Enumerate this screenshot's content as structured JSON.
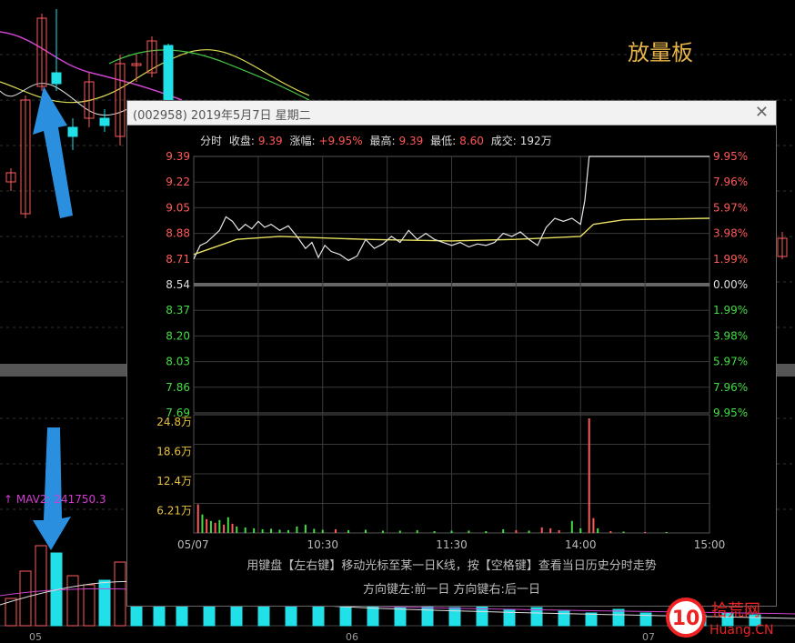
{
  "background": {
    "title": "放量板",
    "ma_label": "↑ MAV",
    "ma_value": "2: 241750.3",
    "x_labels": [
      "05",
      "06",
      "07"
    ]
  },
  "dialog": {
    "title": "(002958) 2019年5月7日 星期二",
    "close_glyph": "✕",
    "info": {
      "mode": "分时",
      "close_label": "收盘:",
      "close_value": "9.39",
      "change_label": "涨幅:",
      "change_value": "+9.95%",
      "high_label": "最高:",
      "high_value": "9.39",
      "low_label": "最低:",
      "low_value": "8.60",
      "volume_label": "成交:",
      "volume_value": "192万"
    },
    "footer_line1": "用键盘【左右键】移动光标至某一日K线，按【空格键】查看当日历史分时走势",
    "footer_line2": "方向键左:前一日   方向键右:后一日"
  },
  "chart_data": {
    "type": "line",
    "price_ticks_up": [
      "9.39",
      "9.22",
      "9.05",
      "8.88",
      "8.71"
    ],
    "price_ticks_mid": "8.54",
    "price_ticks_down": [
      "8.37",
      "8.20",
      "8.03",
      "7.86",
      "7.69"
    ],
    "pct_ticks_up": [
      "9.95%",
      "7.96%",
      "5.97%",
      "3.98%",
      "1.99%"
    ],
    "pct_ticks_mid": "0.00%",
    "pct_ticks_down": [
      "1.99%",
      "3.98%",
      "5.97%",
      "7.96%",
      "9.95%"
    ],
    "volume_ticks": [
      "24.8万",
      "18.6万",
      "12.4万",
      "6.21万"
    ],
    "x_ticks": [
      "05/07",
      "10:30",
      "11:30",
      "14:00",
      "15:00"
    ],
    "ylim": [
      7.69,
      9.39
    ],
    "volume_max": 248000,
    "price_series": [
      {
        "t": 0,
        "p": 8.71
      },
      {
        "t": 3,
        "p": 8.8
      },
      {
        "t": 6,
        "p": 8.82
      },
      {
        "t": 9,
        "p": 8.86
      },
      {
        "t": 12,
        "p": 8.9
      },
      {
        "t": 15,
        "p": 8.99
      },
      {
        "t": 18,
        "p": 8.96
      },
      {
        "t": 21,
        "p": 8.9
      },
      {
        "t": 24,
        "p": 8.94
      },
      {
        "t": 27,
        "p": 8.91
      },
      {
        "t": 30,
        "p": 8.96
      },
      {
        "t": 33,
        "p": 8.92
      },
      {
        "t": 36,
        "p": 8.94
      },
      {
        "t": 40,
        "p": 8.9
      },
      {
        "t": 44,
        "p": 8.93
      },
      {
        "t": 48,
        "p": 8.86
      },
      {
        "t": 52,
        "p": 8.78
      },
      {
        "t": 55,
        "p": 8.82
      },
      {
        "t": 58,
        "p": 8.72
      },
      {
        "t": 61,
        "p": 8.8
      },
      {
        "t": 64,
        "p": 8.76
      },
      {
        "t": 68,
        "p": 8.74
      },
      {
        "t": 72,
        "p": 8.7
      },
      {
        "t": 76,
        "p": 8.73
      },
      {
        "t": 80,
        "p": 8.84
      },
      {
        "t": 84,
        "p": 8.78
      },
      {
        "t": 88,
        "p": 8.81
      },
      {
        "t": 92,
        "p": 8.86
      },
      {
        "t": 96,
        "p": 8.82
      },
      {
        "t": 100,
        "p": 8.9
      },
      {
        "t": 104,
        "p": 8.84
      },
      {
        "t": 108,
        "p": 8.88
      },
      {
        "t": 112,
        "p": 8.84
      },
      {
        "t": 116,
        "p": 8.82
      },
      {
        "t": 120,
        "p": 8.8
      },
      {
        "t": 124,
        "p": 8.82
      },
      {
        "t": 128,
        "p": 8.79
      },
      {
        "t": 132,
        "p": 8.81
      },
      {
        "t": 136,
        "p": 8.8
      },
      {
        "t": 140,
        "p": 8.82
      },
      {
        "t": 144,
        "p": 8.88
      },
      {
        "t": 148,
        "p": 8.86
      },
      {
        "t": 152,
        "p": 8.89
      },
      {
        "t": 156,
        "p": 8.84
      },
      {
        "t": 160,
        "p": 8.8
      },
      {
        "t": 164,
        "p": 8.92
      },
      {
        "t": 168,
        "p": 8.98
      },
      {
        "t": 172,
        "p": 8.96
      },
      {
        "t": 176,
        "p": 8.98
      },
      {
        "t": 180,
        "p": 8.94
      },
      {
        "t": 182,
        "p": 9.1
      },
      {
        "t": 184,
        "p": 9.39
      },
      {
        "t": 190,
        "p": 9.39
      },
      {
        "t": 240,
        "p": 9.39
      }
    ],
    "avg_series": [
      {
        "t": 0,
        "p": 8.74
      },
      {
        "t": 20,
        "p": 8.84
      },
      {
        "t": 40,
        "p": 8.86
      },
      {
        "t": 80,
        "p": 8.84
      },
      {
        "t": 120,
        "p": 8.83
      },
      {
        "t": 150,
        "p": 8.84
      },
      {
        "t": 180,
        "p": 8.86
      },
      {
        "t": 186,
        "p": 8.94
      },
      {
        "t": 200,
        "p": 8.97
      },
      {
        "t": 240,
        "p": 8.98
      }
    ],
    "volume_series": [
      {
        "t": 2,
        "v": 62000
      },
      {
        "t": 4,
        "v": 40000
      },
      {
        "t": 6,
        "v": 30000
      },
      {
        "t": 8,
        "v": 26000
      },
      {
        "t": 10,
        "v": 22000
      },
      {
        "t": 12,
        "v": 28000
      },
      {
        "t": 14,
        "v": 18000
      },
      {
        "t": 16,
        "v": 34000
      },
      {
        "t": 18,
        "v": 20000
      },
      {
        "t": 20,
        "v": 14000
      },
      {
        "t": 24,
        "v": 12000
      },
      {
        "t": 28,
        "v": 10000
      },
      {
        "t": 32,
        "v": 8000
      },
      {
        "t": 36,
        "v": 9000
      },
      {
        "t": 40,
        "v": 7000
      },
      {
        "t": 44,
        "v": 6000
      },
      {
        "t": 48,
        "v": 14000
      },
      {
        "t": 52,
        "v": 18000
      },
      {
        "t": 56,
        "v": 9000
      },
      {
        "t": 60,
        "v": 7000
      },
      {
        "t": 66,
        "v": 8000
      },
      {
        "t": 72,
        "v": 6000
      },
      {
        "t": 80,
        "v": 7000
      },
      {
        "t": 88,
        "v": 5000
      },
      {
        "t": 96,
        "v": 5000
      },
      {
        "t": 104,
        "v": 6000
      },
      {
        "t": 112,
        "v": 4000
      },
      {
        "t": 120,
        "v": 5000
      },
      {
        "t": 128,
        "v": 5000
      },
      {
        "t": 136,
        "v": 4000
      },
      {
        "t": 144,
        "v": 8000
      },
      {
        "t": 150,
        "v": 6000
      },
      {
        "t": 156,
        "v": 5000
      },
      {
        "t": 162,
        "v": 12000
      },
      {
        "t": 166,
        "v": 10000
      },
      {
        "t": 170,
        "v": 6000
      },
      {
        "t": 176,
        "v": 26000
      },
      {
        "t": 180,
        "v": 10000
      },
      {
        "t": 184,
        "v": 248000
      },
      {
        "t": 186,
        "v": 32000
      },
      {
        "t": 188,
        "v": 10000
      },
      {
        "t": 194,
        "v": 4000
      },
      {
        "t": 200,
        "v": 3000
      },
      {
        "t": 210,
        "v": 2000
      },
      {
        "t": 220,
        "v": 2000
      }
    ]
  }
}
